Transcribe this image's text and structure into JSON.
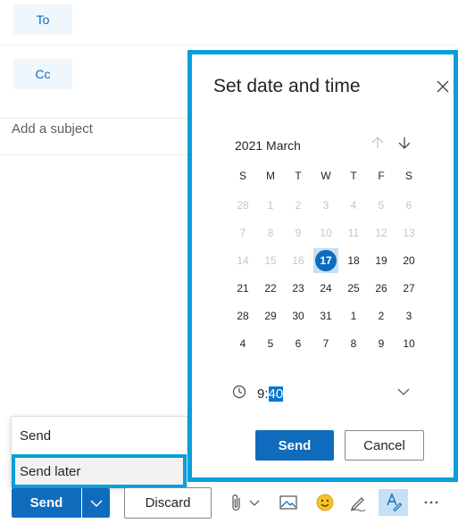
{
  "compose": {
    "to_label": "To",
    "cc_label": "Cc",
    "subject_placeholder": "Add a subject"
  },
  "send_menu": {
    "items": [
      {
        "label": "Send"
      },
      {
        "label": "Send later"
      }
    ]
  },
  "toolbar": {
    "send_label": "Send",
    "discard_label": "Discard",
    "icons": [
      "chevron-down-icon",
      "paperclip-icon",
      "image-icon",
      "emoji-icon",
      "signature-pen-icon",
      "format-text-icon",
      "more-icon"
    ]
  },
  "dialog": {
    "title": "Set date and time",
    "month": "2021 March",
    "weekdays": [
      "S",
      "M",
      "T",
      "W",
      "T",
      "F",
      "S"
    ],
    "weeks": [
      [
        "28",
        "1",
        "2",
        "3",
        "4",
        "5",
        "6"
      ],
      [
        "7",
        "8",
        "9",
        "10",
        "11",
        "12",
        "13"
      ],
      [
        "14",
        "15",
        "16",
        "17",
        "18",
        "19",
        "20"
      ],
      [
        "21",
        "22",
        "23",
        "24",
        "25",
        "26",
        "27"
      ],
      [
        "28",
        "29",
        "30",
        "31",
        "1",
        "2",
        "3"
      ],
      [
        "4",
        "5",
        "6",
        "7",
        "8",
        "9",
        "10"
      ]
    ],
    "selected_day": "17",
    "time_hour": "9:",
    "time_minute": "40",
    "send_label": "Send",
    "cancel_label": "Cancel"
  },
  "colors": {
    "accent": "#0f6cbd",
    "highlight_border": "#0a9fd9"
  }
}
